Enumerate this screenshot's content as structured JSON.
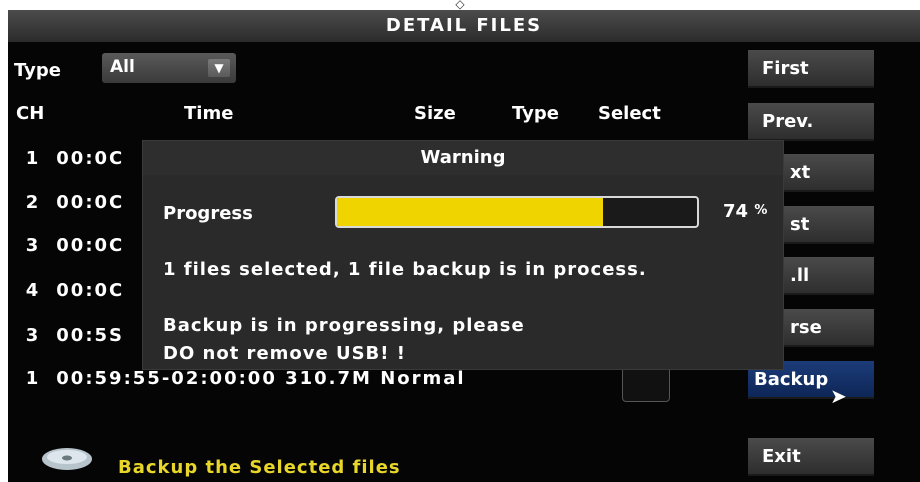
{
  "title": "DETAIL FILES",
  "filter": {
    "label": "Type",
    "value": "All"
  },
  "columns": {
    "ch": "CH",
    "time": "Time",
    "size": "Size",
    "type": "Type",
    "select": "Select"
  },
  "rows": [
    {
      "ch": "1",
      "time": "00:0C"
    },
    {
      "ch": "2",
      "time": "00:0C"
    },
    {
      "ch": "3",
      "time": "00:0C"
    },
    {
      "ch": "4",
      "time": "00:0C"
    },
    {
      "ch": "3",
      "time": "00:5S"
    },
    {
      "ch": "1",
      "text": "00:59:55-02:00:00 310.7M Normal"
    }
  ],
  "sidebar": {
    "buttons": [
      "First",
      "Prev.",
      "xt",
      "st",
      ".ll",
      "rse",
      "Backup"
    ],
    "exit": "Exit"
  },
  "footer": {
    "text": "Backup the Selected files",
    "icon": "disc-icon"
  },
  "modal": {
    "title": "Warning",
    "progress_label": "Progress",
    "progress_value": 0.74,
    "progress_text": "74",
    "progress_unit": "%",
    "line1": "1 files selected, 1 file backup is in process.",
    "line2": "Backup is in progressing, please",
    "line3": "DO not remove USB! !"
  },
  "colors": {
    "accent_yellow": "#f0d400",
    "footer_text": "#e8d628",
    "active_button": "#1c3c78"
  }
}
